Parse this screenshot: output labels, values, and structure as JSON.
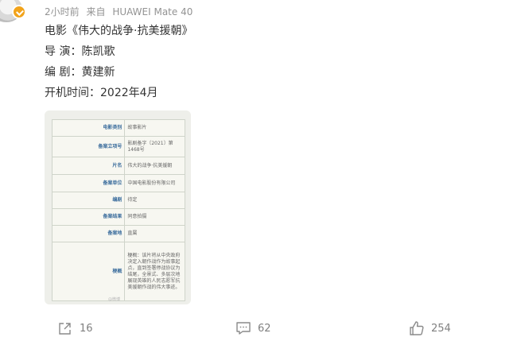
{
  "post": {
    "meta": {
      "time": "2小时前",
      "source_prefix": "来自",
      "source_device": "HUAWEI Mate 40"
    },
    "lines": [
      "电影《伟大的战争·抗美援朝》",
      "导 演：陈凯歌",
      "编 剧：黄建新",
      "开机时间：2022年4月"
    ]
  },
  "image": {
    "rows": [
      {
        "key": "电影类别",
        "value": "故事影片"
      },
      {
        "key": "备案立项号",
        "value": "影剧备字〔2021〕第1468号"
      },
      {
        "key": "片名",
        "value": "伟大的战争·抗美援朝"
      },
      {
        "key": "备案单位",
        "value": "中国电影股份有限公司"
      },
      {
        "key": "编剧",
        "value": "待定"
      },
      {
        "key": "备案结果",
        "value": "同意拍摄"
      },
      {
        "key": "备案地",
        "value": "直属"
      },
      {
        "key": "梗概",
        "value": "梗概：该片将从中央政府决定入朝作战作为故事起点，直到签署停战协议为结尾，全景式、多层次地展现英雄的人民志愿军抗美援朝作战的伟大事迹。"
      }
    ],
    "watermark": "@微博"
  },
  "actions": {
    "share_count": "16",
    "comment_count": "62",
    "like_count": "254"
  },
  "icons": {
    "share": "share-icon",
    "comment": "comment-icon",
    "like": "thumbs-up-icon",
    "verified": "verified-badge-icon"
  },
  "colors": {
    "meta_text": "#939393",
    "verified_badge": "#f2a31b",
    "table_key": "#3e6f9e"
  }
}
